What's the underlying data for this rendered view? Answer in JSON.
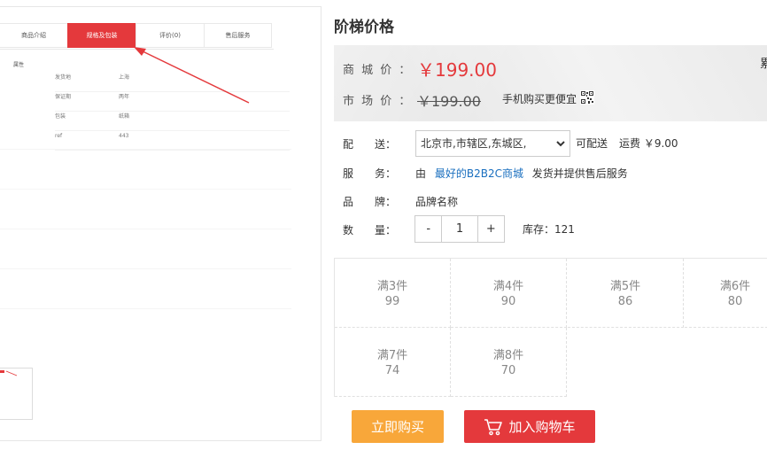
{
  "gallery": {
    "tabs": [
      "商品介绍",
      "规格及包装",
      "评价(0)",
      "售后服务"
    ],
    "attr_title": "属性",
    "attrs": [
      {
        "k": "发货地",
        "v": "上海"
      },
      {
        "k": "保证期",
        "v": "两年"
      },
      {
        "k": "包装",
        "v": "纸箱"
      },
      {
        "k": "ref",
        "v": "443"
      }
    ]
  },
  "product": {
    "title": "阶梯价格",
    "mall_price_label": "商 城 价 ：",
    "mall_price": "￥199.00",
    "market_price_label": "市 场 价 ：",
    "market_price": "￥199.00",
    "mobile_buy": "手机购买更便宜",
    "edge_char": "累"
  },
  "delivery": {
    "label": "配　　送：",
    "selected": "北京市,市辖区,东城区,",
    "status": "可配送",
    "freight": "运费 ￥9.00"
  },
  "service": {
    "label": "服　　务：",
    "prefix": "由",
    "seller": "最好的B2B2C商城",
    "suffix": "发货并提供售后服务"
  },
  "brand": {
    "label": "品　　牌：",
    "value": "品牌名称"
  },
  "quantity": {
    "label": "数　　量：",
    "minus": "-",
    "value": "1",
    "plus": "+",
    "stock": "库存：121"
  },
  "tiers": [
    {
      "cond": "满3件",
      "price": "99"
    },
    {
      "cond": "满4件",
      "price": "90"
    },
    {
      "cond": "满5件",
      "price": "86"
    },
    {
      "cond": "满6件",
      "price": "80"
    },
    {
      "cond": "满7件",
      "price": "74"
    },
    {
      "cond": "满8件",
      "price": "70"
    }
  ],
  "actions": {
    "buy_now": "立即购买",
    "add_cart": "加入购物车"
  },
  "colors": {
    "accent_red": "#e4393c",
    "buy_orange": "#f8a73a",
    "link_blue": "#1a6fbf"
  }
}
